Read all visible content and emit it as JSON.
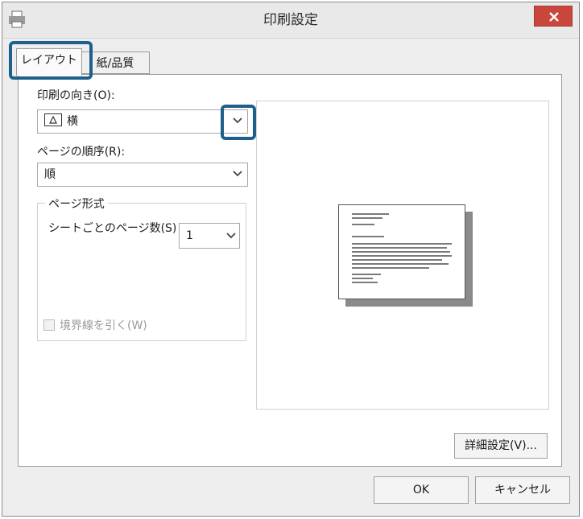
{
  "window": {
    "title": "印刷設定"
  },
  "tabs": [
    {
      "label": "レイアウト",
      "selected": true
    },
    {
      "label": "紙/品質",
      "selected": false
    }
  ],
  "layout": {
    "orientation": {
      "label": "印刷の向き(O):",
      "value": "横",
      "icon": "landscape-page-icon"
    },
    "page_order": {
      "label": "ページの順序(R):",
      "value": "順"
    },
    "page_format": {
      "title": "ページ形式",
      "pages_per_sheet": {
        "label": "シートごとのページ数(S)",
        "value": "1"
      },
      "draw_borders": {
        "label": "境界線を引く(W)",
        "checked": false,
        "enabled": false
      }
    }
  },
  "buttons": {
    "advanced": "詳細設定(V)...",
    "ok": "OK",
    "cancel": "キャンセル"
  },
  "colors": {
    "highlight": "#1f5f8c",
    "close": "#c9463d"
  }
}
